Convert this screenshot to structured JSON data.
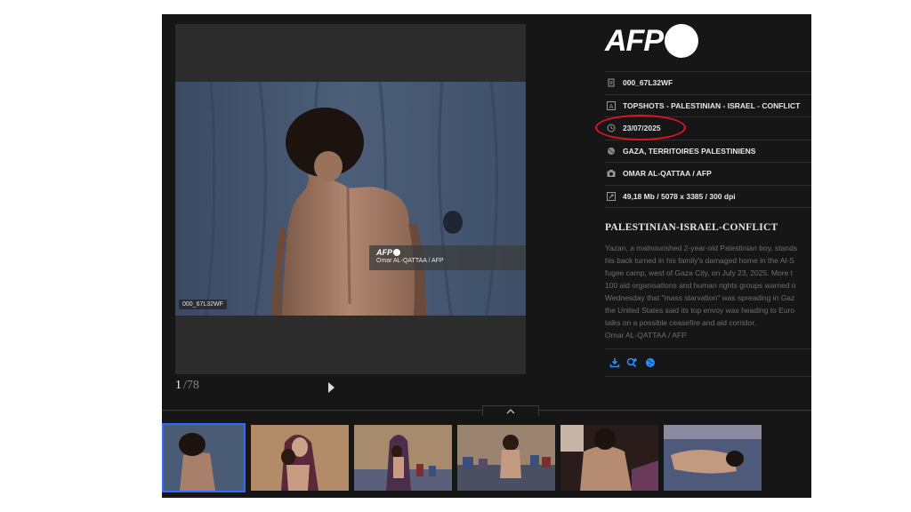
{
  "viewer": {
    "photo_id_badge": "000_67L32WF",
    "overlay": {
      "agency": "AFP",
      "credit": "Omar AL-QATTAA / AFP"
    },
    "counter": {
      "current": "1",
      "total": "/78"
    }
  },
  "brand": {
    "logo_text": "AFP",
    "logo_color": "#ffffff"
  },
  "metadata": {
    "id": "000_67L32WF",
    "headline": "TOPSHOTS - PALESTINIAN - ISRAEL - CONFLICT",
    "date": "23/07/2025",
    "location": "GAZA, TERRITOIRES PALESTINIENS",
    "credit": "OMAR AL-QATTAA / AFP",
    "file_info": "49,18 Mb / 5078 x 3385 / 300 dpi"
  },
  "highlight": {
    "target": "date",
    "color": "#e0141e"
  },
  "section_title": "PALESTINIAN-ISRAEL-CONFLICT",
  "caption_lines": [
    "Yazan, a malnourished 2-year-old Palestinian boy, stands",
    "his back turned in his family's damaged home in the Al-S",
    "fugee camp, west of Gaza City, on July 23, 2025. More t",
    "100 aid organisations and human rights groups warned o",
    "Wednesday that \"mass starvation\" was spreading in Gaz",
    "the United States said its top envoy was heading to Euro",
    "talks on a possible ceasefire and aid corridor.",
    "Omar AL-QATTAA / AFP"
  ],
  "actions": [
    {
      "name": "download-icon",
      "color": "#2a8cff"
    },
    {
      "name": "zoom-in-icon",
      "color": "#2a8cff"
    },
    {
      "name": "globe-icon",
      "color": "#2a8cff"
    }
  ],
  "thumbnails": {
    "count": 6,
    "selected_index": 0,
    "selected_border_color": "#2e6bff"
  }
}
